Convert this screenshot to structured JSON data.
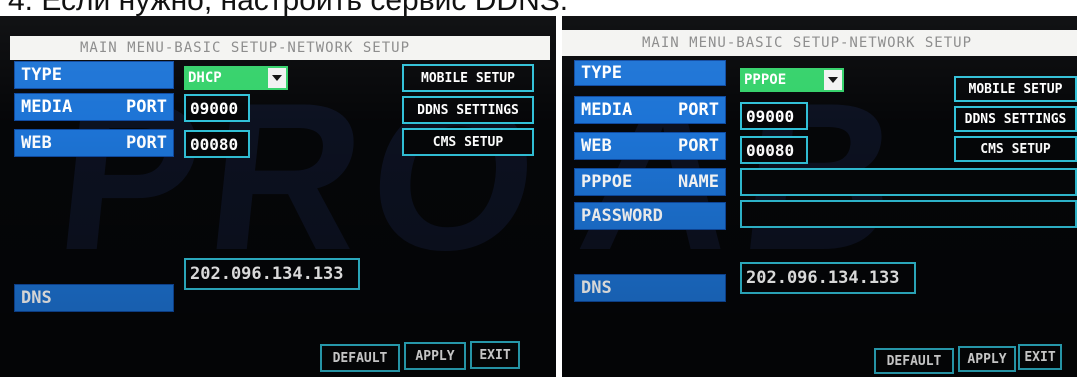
{
  "heading": "4. Если нужно, настроить сервис DDNS.",
  "panels": [
    {
      "title": "MAIN MENU-BASIC SETUP-NETWORK SETUP",
      "type_label": "TYPE",
      "type_value": "DHCP",
      "media_label": "MEDIA",
      "media_port_label": "PORT",
      "media_port_value": "09000",
      "web_label": "WEB",
      "web_port_label": "PORT",
      "web_port_value": "00080",
      "dns_label": "DNS",
      "dns_value": "202.096.134.133",
      "mobile_setup": "MOBILE SETUP",
      "ddns_settings": "DDNS SETTINGS",
      "cms_setup": "CMS SETUP",
      "default": "DEFAULT",
      "apply": "APPLY",
      "exit": "EXIT"
    },
    {
      "title": "MAIN MENU-BASIC SETUP-NETWORK SETUP",
      "type_label": "TYPE",
      "type_value": "PPPOE",
      "media_label": "MEDIA",
      "media_port_label": "PORT",
      "media_port_value": "09000",
      "web_label": "WEB",
      "web_port_label": "PORT",
      "web_port_value": "00080",
      "pppoe_label": "PPPOE",
      "pppoe_name_label": "NAME",
      "pppoe_name_value": "",
      "password_label": "PASSWORD",
      "password_value": "",
      "dns_label": "DNS",
      "dns_value": "202.096.134.133",
      "mobile_setup": "MOBILE SETUP",
      "ddns_settings": "DDNS SETTINGS",
      "cms_setup": "CMS SETUP",
      "default": "DEFAULT",
      "apply": "APPLY",
      "exit": "EXIT"
    }
  ],
  "colors": {
    "label_bg": "#1d74d6",
    "field_border": "#31c1d8",
    "select_bg": "#35d26b",
    "screen_bg": "#050608"
  },
  "icons": {
    "dropdown": "chevron-down-icon"
  }
}
